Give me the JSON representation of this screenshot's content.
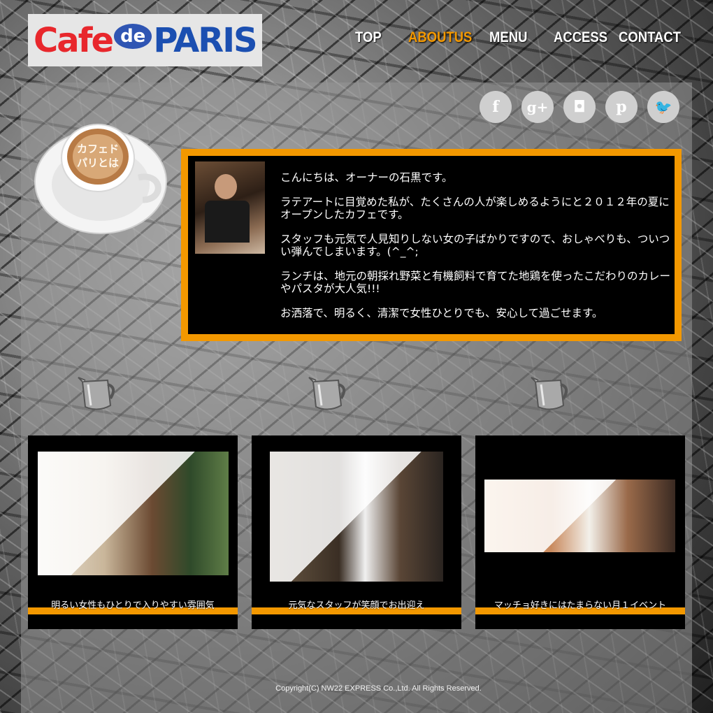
{
  "logo": {
    "cafe": "Cafe",
    "de": "de",
    "paris": "PARIS"
  },
  "nav": {
    "items": [
      {
        "label": "TOP"
      },
      {
        "label": "ABOUTUS"
      },
      {
        "label": "MENU"
      },
      {
        "label": "ACCESS"
      },
      {
        "label": "CONTACT"
      }
    ],
    "active": "ABOUTUS",
    "active_color": "#f39800"
  },
  "social": {
    "icons": [
      {
        "name": "facebook-icon",
        "glyph": "f"
      },
      {
        "name": "google-plus-icon",
        "glyph": "g+"
      },
      {
        "name": "instagram-icon",
        "glyph": "◘"
      },
      {
        "name": "pinterest-icon",
        "glyph": "p"
      },
      {
        "name": "twitter-icon",
        "glyph": "🐦"
      }
    ]
  },
  "latte_art": {
    "line1": "カフェド",
    "line2": "パリとは"
  },
  "about": {
    "paragraphs": [
      "こんにちは、オーナーの石黒です。",
      "ラテアートに目覚めた私が、たくさんの人が楽しめるようにと２０１２年の夏にオープンしたカフェです。",
      "スタッフも元気で人見知りしない女の子ばかりですので、おしゃべりも、ついつい弾んでしまいます。(^_^;",
      "ランチは、地元の朝採れ野菜と有機飼料で育てた地鶏を使ったこだわりのカレーやパスタが大人気!!!",
      "お洒落で、明るく、清潔で女性ひとりでも、安心して過ごせます。"
    ]
  },
  "cards": [
    {
      "caption": "明るい女性もひとりで入りやすい雰囲気"
    },
    {
      "caption": "元気なスタッフが笑顔でお出迎え"
    },
    {
      "caption": "マッチョ好きにはたまらない月１イベント"
    }
  ],
  "footer": {
    "copyright": "Copyright(C) NW22 EXPRESS Co.,Ltd. All Rights Reserved."
  },
  "colors": {
    "accent": "#f39800",
    "logo_red": "#e8272c",
    "logo_blue": "#1b4fb1"
  }
}
